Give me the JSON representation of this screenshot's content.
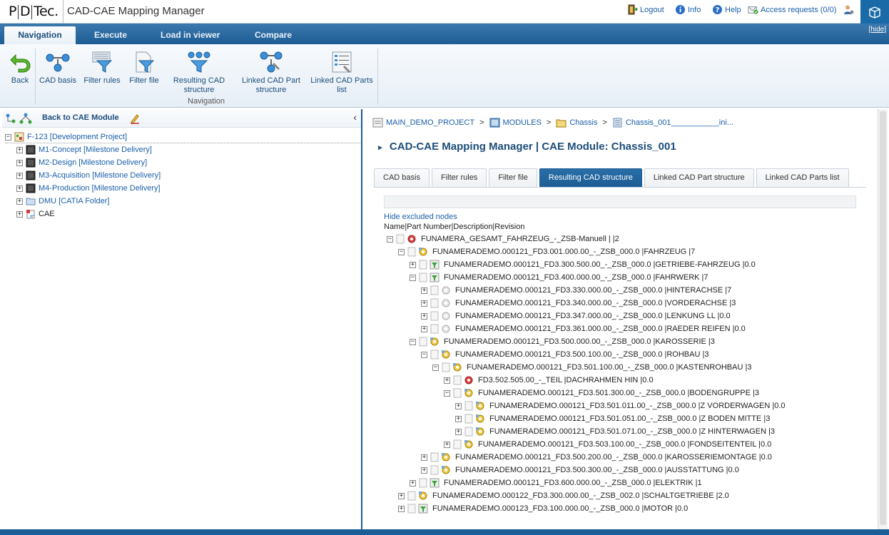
{
  "app": {
    "logo": "PDTec.",
    "title": "CAD-CAE Mapping Manager"
  },
  "toplinks": {
    "logout": "Logout",
    "info": "Info",
    "help": "Help",
    "access_requests": "Access requests (0/0)"
  },
  "tabs": [
    "Navigation",
    "Execute",
    "Load in viewer",
    "Compare"
  ],
  "hide_label": "[hide]",
  "ribbon": {
    "back": "Back",
    "cad_basis": "CAD basis",
    "filter_rules": "Filter rules",
    "filter_file": "Filter file",
    "resulting_cad_structure": "Resulting CAD structure",
    "linked_cad_part_structure": "Linked CAD Part structure",
    "linked_cad_parts_list": "Linked CAD Parts list",
    "group_label": "Navigation"
  },
  "left": {
    "back_to_cae": "Back to CAE Module",
    "collapse_glyph": "‹",
    "tree": [
      {
        "label": "F-123 [Development Project]",
        "level": 0,
        "expanded": true
      },
      {
        "label": "M1-Concept [Milestone Delivery]",
        "level": 1
      },
      {
        "label": "M2-Design [Milestone Delivery]",
        "level": 1
      },
      {
        "label": "M3-Acquisition [Milestone Delivery]",
        "level": 1
      },
      {
        "label": "M4-Production [Milestone Delivery]",
        "level": 1
      },
      {
        "label": "DMU [CATIA Folder]",
        "level": 1
      },
      {
        "label": "CAE",
        "level": 1
      }
    ]
  },
  "breadcrumb": [
    "MAIN_DEMO_PROJECT",
    "MODULES",
    "Chassis",
    "Chassis_001___________ini..."
  ],
  "section_title": "CAD-CAE Mapping Manager | CAE Module: Chassis_001",
  "subtabs": [
    "CAD basis",
    "Filter rules",
    "Filter file",
    "Resulting CAD structure",
    "Linked CAD Part structure",
    "Linked CAD Parts list"
  ],
  "hide_excluded": "Hide excluded nodes",
  "column_header": "Name|Part Number|Description|Revision",
  "tree": [
    {
      "level": 0,
      "pm": "−",
      "kind": "red",
      "label": "FUNAMERA_GESAMT_FAHRZEUG_-_ZSB-Manuell | |2"
    },
    {
      "level": 1,
      "pm": "−",
      "kind": "yellow",
      "label": "FUNAMERADEMO.000121_FD3.001.000.00_-_ZSB_000.0 |FAHRZEUG |7"
    },
    {
      "level": 2,
      "pm": "+",
      "kind": "filter",
      "label": "FUNAMERADEMO.000121_FD3.300.500.00_-_ZSB_000.0 |GETRIEBE-FAHRZEUG |0.0"
    },
    {
      "level": 2,
      "pm": "−",
      "kind": "filter",
      "label": "FUNAMERADEMO.000121_FD3.400.000.00_-_ZSB_000.0 |FAHRWERK |7"
    },
    {
      "level": 3,
      "pm": "+",
      "kind": "gray",
      "label": "FUNAMERADEMO.000121_FD3.330.000.00_-_ZSB_000.0 |HINTERACHSE |7"
    },
    {
      "level": 3,
      "pm": "+",
      "kind": "gray",
      "label": "FUNAMERADEMO.000121_FD3.340.000.00_-_ZSB_000.0 |VORDERACHSE |3"
    },
    {
      "level": 3,
      "pm": "+",
      "kind": "gray",
      "label": "FUNAMERADEMO.000121_FD3.347.000.00_-_ZSB_000.0 |LENKUNG LL |0.0"
    },
    {
      "level": 3,
      "pm": "+",
      "kind": "gray",
      "label": "FUNAMERADEMO.000121_FD3.361.000.00_-_ZSB_000.0 |RAEDER REIFEN |0.0"
    },
    {
      "level": 2,
      "pm": "−",
      "kind": "yellow",
      "label": "FUNAMERADEMO.000121_FD3.500.000.00_-_ZSB_000.0 |KAROSSERIE |3"
    },
    {
      "level": 3,
      "pm": "−",
      "kind": "yellow",
      "label": "FUNAMERADEMO.000121_FD3.500.100.00_-_ZSB_000.0 |ROHBAU |3"
    },
    {
      "level": 4,
      "pm": "−",
      "kind": "yellow",
      "label": "FUNAMERADEMO.000121_FD3.501.100.00_-_ZSB_000.0 |KASTENROHBAU |3"
    },
    {
      "level": 5,
      "pm": "+",
      "kind": "red",
      "label": "FD3.502.505.00_-_TEIL |DACHRAHMEN HIN |0.0"
    },
    {
      "level": 5,
      "pm": "−",
      "kind": "yellow",
      "label": "FUNAMERADEMO.000121_FD3.501.300.00_-_ZSB_000.0 |BODENGRUPPE |3"
    },
    {
      "level": 6,
      "pm": "+",
      "kind": "yellow",
      "label": "FUNAMERADEMO.000121_FD3.501.011.00_-_ZSB_000.0 |Z VORDERWAGEN |0.0"
    },
    {
      "level": 6,
      "pm": "+",
      "kind": "yellow",
      "label": "FUNAMERADEMO.000121_FD3.501.051.00_-_ZSB_000.0 |Z BODEN MITTE |3"
    },
    {
      "level": 6,
      "pm": "+",
      "kind": "yellow",
      "label": "FUNAMERADEMO.000121_FD3.501.071.00_-_ZSB_000.0 |Z HINTERWAGEN |3"
    },
    {
      "level": 5,
      "pm": "+",
      "kind": "yellow",
      "label": "FUNAMERADEMO.000121_FD3.503.100.00_-_ZSB_000.0 |FONDSEITENTEIL |0.0"
    },
    {
      "level": 3,
      "pm": "+",
      "kind": "yellow",
      "label": "FUNAMERADEMO.000121_FD3.500.200.00_-_ZSB_000.0 |KAROSSERIEMONTAGE |0.0"
    },
    {
      "level": 3,
      "pm": "+",
      "kind": "yellow",
      "label": "FUNAMERADEMO.000121_FD3.500.300.00_-_ZSB_000.0 |AUSSTATTUNG |0.0"
    },
    {
      "level": 2,
      "pm": "+",
      "kind": "filter",
      "label": "FUNAMERADEMO.000121_FD3.600.000.00_-_ZSB_000.0 |ELEKTRIK |1"
    },
    {
      "level": 1,
      "pm": "+",
      "kind": "yellow",
      "label": "FUNAMERADEMO.000122_FD3.300.000.00_-_ZSB_002.0 |SCHALTGETRIEBE |2.0"
    },
    {
      "level": 1,
      "pm": "+",
      "kind": "filter",
      "label": "FUNAMERADEMO.000123_FD3.100.000.00_-_ZSB_000.0 |MOTOR |0.0"
    }
  ],
  "colors": {
    "accent": "#1d5d95",
    "link": "#1a5fa8"
  }
}
